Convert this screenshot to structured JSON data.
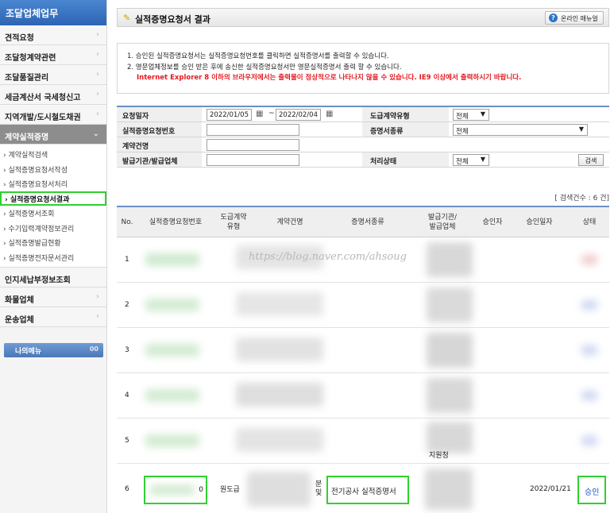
{
  "sidebar": {
    "header": "조달업체업무",
    "items": [
      {
        "label": "견적요청"
      },
      {
        "label": "조달청계약관련"
      },
      {
        "label": "조달품질관리"
      },
      {
        "label": "세금계산서 국세청신고"
      },
      {
        "label": "지역개발/도시철도채권"
      },
      {
        "label": "계약실적증명"
      }
    ],
    "sub_items": [
      {
        "label": "계약실적검색"
      },
      {
        "label": "실적증명요청서작성"
      },
      {
        "label": "실적증명요청서처리"
      },
      {
        "label": "실적증명요청서결과"
      },
      {
        "label": "실적증명서조회"
      },
      {
        "label": "수기입력계약정보관리"
      },
      {
        "label": "실적증명발급현황"
      },
      {
        "label": "실적증명전자문서관리"
      }
    ],
    "items_after": [
      {
        "label": "인지세납부정보조회"
      },
      {
        "label": "화물업체"
      },
      {
        "label": "운송업체"
      }
    ],
    "my_menu": "나의메뉴",
    "my_menu_arrow": "00",
    "chevron": "›"
  },
  "header": {
    "title": "실적증명요청서 결과",
    "manual_button": "온라인 매뉴얼"
  },
  "notes": {
    "line1": "1. 승인된 실적증명요청서는 실적증명요청번호를 클릭하면 실적증명서를 출력할 수 있습니다.",
    "line2": "2. 영문업체정보를 승인 받은 후에 송신한 실적증명요청서만 영문실적증명서 출력 할 수 있습니다.",
    "warning": "Internet Explorer 8 이하의 브라우저에서는 출력물이 정상적으로 나타나지 않을 수 있습니다. IE9 이상에서 출력하시기 바랍니다."
  },
  "search": {
    "request_date_label": "요청일자",
    "date_from": "2022/01/05",
    "date_to": "2022/02/04",
    "tilde": "~",
    "contract_type_label": "도급계약유형",
    "contract_type_value": "전체",
    "request_no_label": "실적증명요청번호",
    "cert_type_label": "증명서종류",
    "cert_type_value": "전체",
    "contract_name_label": "계약건명",
    "issuer_label": "발급기관/발급업체",
    "status_label": "처리상태",
    "status_value": "전체",
    "search_button": "검색"
  },
  "results": {
    "count_text": "[ 검색건수 : 6 건]",
    "columns": [
      "No.",
      "실적증명요청번호",
      "도급계약\n유형",
      "계약건명",
      "증명서종류",
      "발급기관/\n발급업체",
      "승인자",
      "승인일자",
      "상태"
    ],
    "rows": [
      {
        "no": "1"
      },
      {
        "no": "2"
      },
      {
        "no": "3"
      },
      {
        "no": "4"
      },
      {
        "no": "5",
        "issuer_tail": "지원청"
      },
      {
        "no": "6",
        "contract_type": "원도급",
        "contract_name_tail": "분\n및",
        "cert_type": "전기공사 실적증명서",
        "approval_date": "2022/01/21",
        "status": "승인",
        "request_no_tail": "0"
      }
    ]
  },
  "watermark": "https://blog.naver.com/ahsoug",
  "colors": {
    "highlight": "#2fd12f",
    "warning": "#e4191f",
    "status_link": "#1a4fd0",
    "sidebar_header": "#2d64b4"
  }
}
